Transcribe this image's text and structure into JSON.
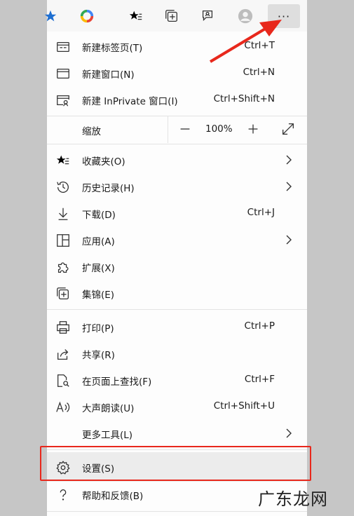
{
  "menu": {
    "items": [
      {
        "label": "新建标签页(T)",
        "shortcut": "Ctrl+T"
      },
      {
        "label": "新建窗口(N)",
        "shortcut": "Ctrl+N"
      },
      {
        "label": "新建 InPrivate 窗口(I)",
        "shortcut": "Ctrl+Shift+N"
      },
      {
        "label": "缩放",
        "shortcut": ""
      },
      {
        "label": "收藏夹(O)",
        "shortcut": ""
      },
      {
        "label": "历史记录(H)",
        "shortcut": ""
      },
      {
        "label": "下载(D)",
        "shortcut": "Ctrl+J"
      },
      {
        "label": "应用(A)",
        "shortcut": ""
      },
      {
        "label": "扩展(X)",
        "shortcut": ""
      },
      {
        "label": "集锦(E)",
        "shortcut": ""
      },
      {
        "label": "打印(P)",
        "shortcut": "Ctrl+P"
      },
      {
        "label": "共享(R)",
        "shortcut": ""
      },
      {
        "label": "在页面上查找(F)",
        "shortcut": "Ctrl+F"
      },
      {
        "label": "大声朗读(U)",
        "shortcut": "Ctrl+Shift+U"
      },
      {
        "label": "更多工具(L)",
        "shortcut": ""
      },
      {
        "label": "设置(S)",
        "shortcut": ""
      },
      {
        "label": "帮助和反馈(B)",
        "shortcut": ""
      }
    ],
    "zoom": {
      "minus": "—",
      "value": "100%",
      "plus": "+"
    }
  },
  "toolbar": {
    "more_label": "···"
  },
  "watermark": "广东龙网",
  "colors": {
    "highlight_box": "#e8281c",
    "arrow": "#e8281c",
    "menu_bg": "#fdfdfd"
  }
}
